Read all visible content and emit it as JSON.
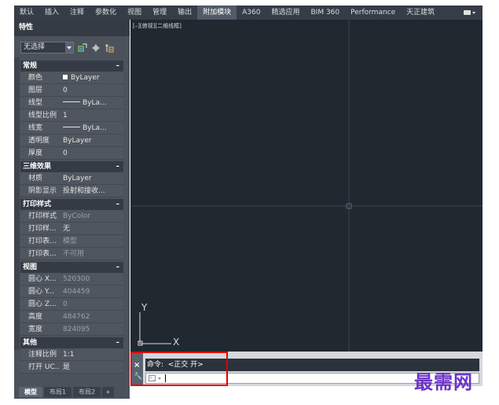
{
  "ribbon": {
    "tabs": [
      {
        "label": "默认",
        "active": false
      },
      {
        "label": "插入",
        "active": false
      },
      {
        "label": "注释",
        "active": false
      },
      {
        "label": "参数化",
        "active": false
      },
      {
        "label": "视图",
        "active": false
      },
      {
        "label": "管理",
        "active": false
      },
      {
        "label": "输出",
        "active": false
      },
      {
        "label": "附加模块",
        "active": true
      },
      {
        "label": "A360",
        "active": false
      },
      {
        "label": "精选应用",
        "active": false
      },
      {
        "label": "BIM 360",
        "active": false
      },
      {
        "label": "Performance",
        "active": false
      },
      {
        "label": "天正建筑",
        "active": false
      }
    ]
  },
  "palette": {
    "title": "特性",
    "selection": "无选择",
    "sections": [
      {
        "title": "常规",
        "rows": [
          {
            "name": "颜色",
            "value": "ByLayer",
            "kind": "swatch"
          },
          {
            "name": "图层",
            "value": "0"
          },
          {
            "name": "线型",
            "value": "ByLa...",
            "kind": "line"
          },
          {
            "name": "线型比例",
            "value": "1"
          },
          {
            "name": "线宽",
            "value": "ByLa...",
            "kind": "line"
          },
          {
            "name": "透明度",
            "value": "ByLayer"
          },
          {
            "name": "厚度",
            "value": "0"
          }
        ]
      },
      {
        "title": "三维效果",
        "rows": [
          {
            "name": "材质",
            "value": "ByLayer"
          },
          {
            "name": "阴影显示",
            "value": "投射和接收..."
          }
        ]
      },
      {
        "title": "打印样式",
        "rows": [
          {
            "name": "打印样式",
            "value": "ByColor",
            "dim": true
          },
          {
            "name": "打印样...",
            "value": "无"
          },
          {
            "name": "打印表...",
            "value": "模型",
            "dim": true
          },
          {
            "name": "打印表...",
            "value": "不可用",
            "dim": true
          }
        ]
      },
      {
        "title": "视图",
        "rows": [
          {
            "name": "圆心 X...",
            "value": "520300",
            "dim": true
          },
          {
            "name": "圆心 Y...",
            "value": "404459",
            "dim": true
          },
          {
            "name": "圆心 Z...",
            "value": "0",
            "dim": true
          },
          {
            "name": "高度",
            "value": "484762",
            "dim": true
          },
          {
            "name": "宽度",
            "value": "824095",
            "dim": true
          }
        ]
      },
      {
        "title": "其他",
        "rows": [
          {
            "name": "注释比例",
            "value": "1:1"
          },
          {
            "name": "打开 UC...",
            "value": "是"
          }
        ]
      }
    ],
    "collapse_symbol": "–"
  },
  "layout_tabs": [
    {
      "label": "模型",
      "active": true
    },
    {
      "label": "布局1",
      "active": false
    },
    {
      "label": "布局2",
      "active": false
    },
    {
      "label": "+",
      "active": false
    }
  ],
  "canvas": {
    "viewport_label": "[–][俯视][二维线框]",
    "ucs_x": "X",
    "ucs_y": "Y"
  },
  "command": {
    "history": "命令:  <正交 开>",
    "close_symbol": "×",
    "input_value": ""
  },
  "watermark": "最需网",
  "colors": {
    "ribbon_bg": "#363d47",
    "palette_bg": "#4b525b",
    "canvas_bg": "#212830",
    "highlight": "#e30000",
    "watermark": "#6b34c7"
  }
}
